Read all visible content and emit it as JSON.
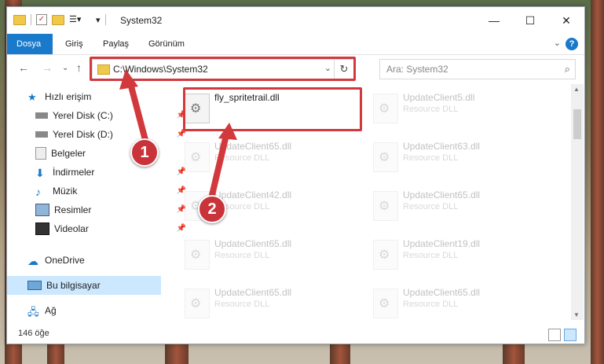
{
  "window": {
    "title": "System32"
  },
  "ribbon": {
    "tabs": [
      "Dosya",
      "Giriş",
      "Paylaş",
      "Görünüm"
    ]
  },
  "address": {
    "path": "C:\\Windows\\System32"
  },
  "search": {
    "placeholder": "Ara: System32"
  },
  "sidebar": {
    "items": [
      {
        "label": "Hızlı erişim",
        "icon": "star-icon"
      },
      {
        "label": "Yerel Disk (C:)",
        "icon": "drive-icon"
      },
      {
        "label": "Yerel Disk (D:)",
        "icon": "drive-icon"
      },
      {
        "label": "Belgeler",
        "icon": "documents-icon"
      },
      {
        "label": "İndirmeler",
        "icon": "download-icon"
      },
      {
        "label": "Müzik",
        "icon": "music-icon"
      },
      {
        "label": "Resimler",
        "icon": "pictures-icon"
      },
      {
        "label": "Videolar",
        "icon": "video-icon"
      },
      {
        "label": "OneDrive",
        "icon": "cloud-icon"
      },
      {
        "label": "Bu bilgisayar",
        "icon": "computer-icon"
      },
      {
        "label": "Ağ",
        "icon": "network-icon"
      }
    ]
  },
  "files": [
    {
      "name": "fly_spritetrail.dll",
      "type": ""
    },
    {
      "name": "UpdateClient5.dll",
      "type": "Resource DLL"
    },
    {
      "name": "UpdateClient65.dll",
      "type": "Resource DLL"
    },
    {
      "name": "UpdateClient63.dll",
      "type": "Resource DLL"
    },
    {
      "name": "UpdateClient42.dll",
      "type": "Resource DLL"
    },
    {
      "name": "UpdateClient65.dll",
      "type": "Resource DLL"
    },
    {
      "name": "UpdateClient65.dll",
      "type": "Resource DLL"
    },
    {
      "name": "UpdateClient19.dll",
      "type": "Resource DLL"
    },
    {
      "name": "UpdateClient65.dll",
      "type": "Resource DLL"
    },
    {
      "name": "UpdateClient65.dll",
      "type": "Resource DLL"
    }
  ],
  "status": {
    "count": "146 öğe"
  },
  "callouts": [
    "1",
    "2"
  ],
  "colors": {
    "accent": "#1979ca",
    "highlight": "#d2393d"
  }
}
